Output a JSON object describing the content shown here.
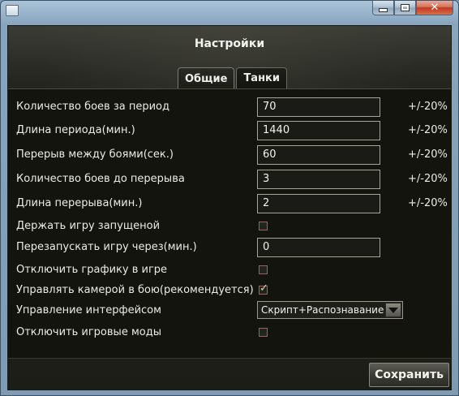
{
  "window": {
    "minimize_glyph": "",
    "maximize_glyph": "",
    "close_glyph": "✕"
  },
  "heading": "Настройки",
  "tabs": [
    {
      "label": "Общие"
    },
    {
      "label": "Танки"
    }
  ],
  "settings": {
    "battles_per_period": {
      "label": "Количество боев за период",
      "value": "70",
      "range": "+/-20%"
    },
    "period_length": {
      "label": "Длина периода(мин.)",
      "value": "1440",
      "range": "+/-20%"
    },
    "break_between_battles": {
      "label": "Перерыв между боями(сек.)",
      "value": "60",
      "range": "+/-20%"
    },
    "battles_before_break": {
      "label": "Количество боев до перерыва",
      "value": "3",
      "range": "+/-20%"
    },
    "break_length": {
      "label": "Длина перерыва(мин.)",
      "value": "2",
      "range": "+/-20%"
    },
    "keep_game_running": {
      "label": "Держать игру запущеной",
      "checked": false
    },
    "restart_game_after": {
      "label": "Перезапускать игру через(мин.)",
      "value": "0"
    },
    "disable_graphics": {
      "label": "Отключить графику в игре",
      "checked": false
    },
    "control_camera": {
      "label": "Управлять камерой в бою(рекомендуется)",
      "checked": true
    },
    "interface_control": {
      "label": "Управление интерфейсом",
      "selected": "Скрипт+Распознавание"
    },
    "disable_game_mods": {
      "label": "Отключить игровые моды",
      "checked": false
    }
  },
  "save_label": "Сохранить"
}
